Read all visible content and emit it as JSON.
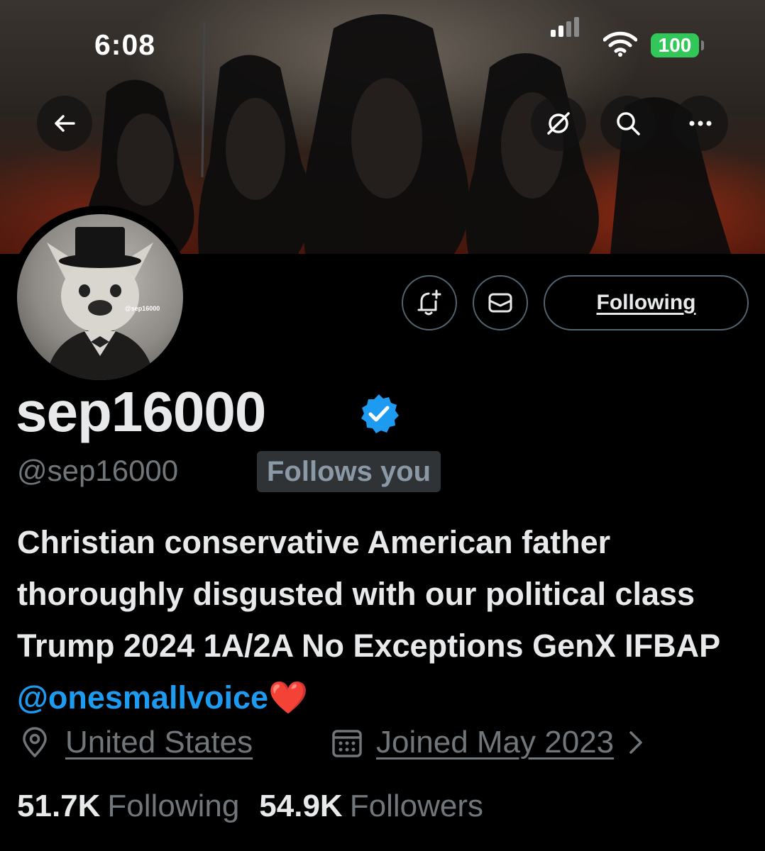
{
  "status_bar": {
    "time": "6:08",
    "battery": "100"
  },
  "header": {
    "back_icon": "arrow-left-icon",
    "grok_icon": "slashed-circle-icon",
    "search_icon": "search-icon",
    "more_icon": "ellipsis-icon"
  },
  "avatar": {
    "watermark": "@sep16000"
  },
  "actions": {
    "notify_icon": "bell-plus-icon",
    "message_icon": "envelope-icon",
    "follow_label": "Following"
  },
  "profile": {
    "display_name": "sep16000",
    "handle": "@sep16000",
    "follows_you": "Follows you",
    "bio_text": "Christian conservative American father thoroughly disgusted with our political class Trump 2024 1A/2A No Exceptions GenX IFBAP ",
    "bio_mention": "@onesmallvoice",
    "bio_emoji": "❤️",
    "location": "United States",
    "joined": "Joined May 2023"
  },
  "stats": {
    "following_count": "51.7K",
    "following_label": "Following",
    "followers_count": "54.9K",
    "followers_label": "Followers"
  },
  "colors": {
    "background": "#000000",
    "text": "#e7e9ea",
    "muted": "#71767b",
    "accent": "#1d9bf0",
    "battery": "#33c759"
  }
}
